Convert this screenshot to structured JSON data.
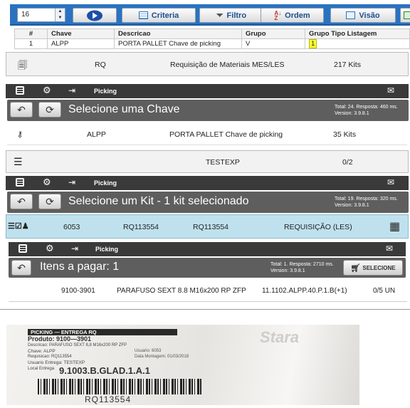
{
  "toolbar": {
    "page_size": "16",
    "buttons": {
      "criteria": "Criteria",
      "filtro": "Filtro",
      "ordem": "Ordem",
      "visao": "Visão"
    }
  },
  "grid": {
    "headers": [
      "#",
      "Chave",
      "Descricao",
      "Grupo",
      "Grupo Tipo Listagem"
    ],
    "row": [
      "1",
      "ALPP",
      "PORTA PALLET Chave de picking",
      "V",
      "1"
    ]
  },
  "rq_row": {
    "code": "RQ",
    "description": "Requisição de Materiais MES/LES",
    "kits": "217 Kits"
  },
  "picking1": {
    "app": "Picking",
    "title": "Selecione uma Chave",
    "meta1": "Total: 24. Resposta: 460 ms.",
    "meta2": "Version: 3.9.8.1",
    "row": {
      "chave": "ALPP",
      "descricao": "PORTA PALLET Chave de picking",
      "kits": "35 Kits"
    }
  },
  "testexp_row": {
    "name": "TESTEXP",
    "count": "0/2"
  },
  "picking2": {
    "app": "Picking",
    "title": "Selecione um Kit - 1 kit selecionado",
    "meta1": "Total: 19. Resposta: 320 ms.",
    "meta2": "Version: 3.9.8.1",
    "row": {
      "id": "6053",
      "rq1": "RQ113554",
      "rq2": "RQ113554",
      "tipo": "REQUISIÇÃO (LES)"
    }
  },
  "picking3": {
    "app": "Picking",
    "title": "Itens a pagar: 1",
    "meta1": "Total: 1. Resposta: 2710 ms.",
    "meta2": "Version: 3.9.8.1",
    "select_label": "SELECIONE",
    "row": {
      "codigo": "9100-3901",
      "descricao": "PARAFUSO SEXT 8.8 M16x200 RP ZFP",
      "local": "11.1102.ALPP.40.P.1.B(+1)",
      "qtd": "0/5 UN"
    }
  },
  "label_photo": {
    "header": "PICKING — ENTREGA RQ",
    "produto": "Produto: 9100—3901",
    "descricao": "Descricao: PARAFUSO SEXT 8,8 M16x200 RP ZFP",
    "chave": "Chave: ALPP",
    "usuario": "Usuario: 6053",
    "requisicao": "Requisicao: RQ113554",
    "data": "Data Montagem: 01/03/2018",
    "usuario_entrega": "Usuario Entrega: TESTEXP",
    "local_label": "Local Entrega",
    "local": "9.1003.B.GLAD.1.A.1",
    "barcode_text": "RQ113554",
    "brand": "Stara"
  },
  "colors": {
    "toolbar": "#2a72c0",
    "dark_bar": "#3a3a3a",
    "header_box": "#5e5e5e",
    "selected_row": "#bfe1ee",
    "yellow": "#ffff33"
  }
}
